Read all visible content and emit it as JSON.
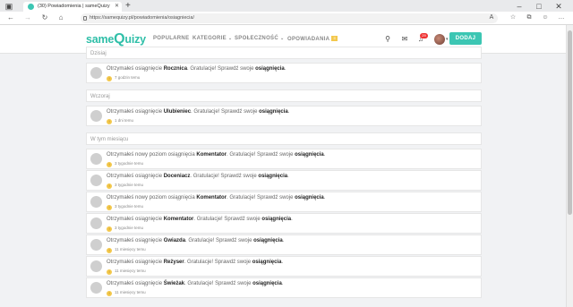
{
  "browser": {
    "tab_title": "(30) Powiadomienia | sameQuizy",
    "url": "https://samequizy.pl/powiadomienia/osiagniecia/"
  },
  "header": {
    "logo_same": "same",
    "logo_q": "Q",
    "logo_uizy": "uizy",
    "menu": [
      {
        "label": "POPULARNE"
      },
      {
        "label": "KATEGORIE",
        "arrow": "⌄"
      },
      {
        "label": "SPOŁECZNOŚĆ",
        "arrow": "⌄"
      },
      {
        "label": "OPOWIADANIA",
        "badge": "≡"
      }
    ],
    "notif_count": "29",
    "add_button": "DODAJ"
  },
  "sections": [
    {
      "label": "Dzisiaj",
      "items": [
        {
          "pre": "Otrzymałeś osiągnięcie ",
          "bold": "Rocznica",
          "post": ". Gratulacje! Sprawdź swoje ",
          "link": "osiągnięcia",
          "end": ".",
          "time": "7 godzin temu"
        }
      ]
    },
    {
      "label": "Wczoraj",
      "items": [
        {
          "pre": "Otrzymałeś osiągnięcie ",
          "bold": "Ulubieniec",
          "post": ". Gratulacje! Sprawdź swoje ",
          "link": "osiągnięcia",
          "end": ".",
          "time": "1 dni temu"
        }
      ]
    },
    {
      "label": "W tym miesiącu",
      "items": [
        {
          "pre": "Otrzymałeś nowy poziom osiągnięcia ",
          "bold": "Komentator",
          "post": ". Gratulacje! Sprawdź swoje ",
          "link": "osiągnięcia",
          "end": ".",
          "time": "3 tygodnie temu"
        },
        {
          "pre": "Otrzymałeś osiągnięcie ",
          "bold": "Doceniacz",
          "post": ". Gratulacje! Sprawdź swoje ",
          "link": "osiągnięcia",
          "end": ".",
          "time": "3 tygodnie temu"
        },
        {
          "pre": "Otrzymałeś nowy poziom osiągnięcia ",
          "bold": "Komentator",
          "post": ". Gratulacje! Sprawdź swoje ",
          "link": "osiągnięcia",
          "end": ".",
          "time": "3 tygodnie temu"
        },
        {
          "pre": "Otrzymałeś osiągnięcie ",
          "bold": "Komentator",
          "post": ". Gratulacje! Sprawdź swoje ",
          "link": "osiągnięcia",
          "end": ".",
          "time": "3 tygodnie temu"
        },
        {
          "pre": "Otrzymałeś osiągnięcie ",
          "bold": "Gwiazda",
          "post": ". Gratulacje! Sprawdź swoje ",
          "link": "osiągnięcia",
          "end": ".",
          "time": "11 miesięcy temu"
        },
        {
          "pre": "Otrzymałeś osiągnięcie ",
          "bold": "Reżyser",
          "post": ". Gratulacje! Sprawdź swoje ",
          "link": "osiągnięcia",
          "end": ".",
          "time": "11 miesięcy temu"
        },
        {
          "pre": "Otrzymałeś osiągnięcie ",
          "bold": "Świeżak",
          "post": ". Gratulacje! Sprawdź swoje ",
          "link": "osiągnięcia",
          "end": ".",
          "time": "11 miesięcy temu"
        }
      ]
    }
  ],
  "colors": {
    "accent": "#3cc6b3",
    "trophy": "#f3c84d",
    "badge": "#e33333"
  }
}
